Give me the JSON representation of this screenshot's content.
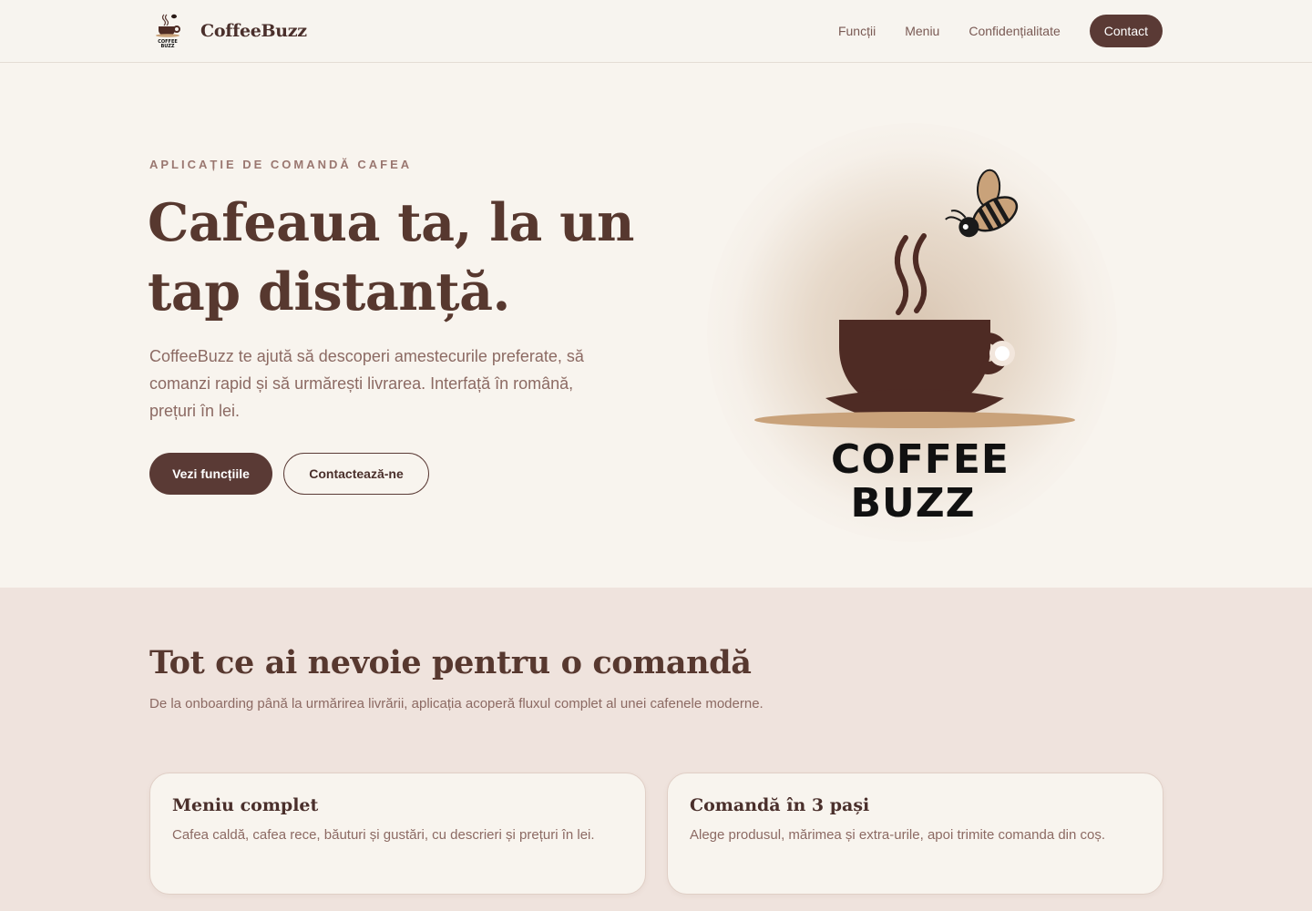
{
  "nav": {
    "brand": "CoffeeBuzz",
    "links": [
      "Funcții",
      "Meniu",
      "Confidențialitate"
    ],
    "contact": "Contact"
  },
  "hero": {
    "eyebrow": "APLICAȚIE DE COMANDĂ CAFEA",
    "title": "Cafeaua ta, la un tap distanță.",
    "description": "CoffeeBuzz te ajută să descoperi amestecurile preferate, să comanzi rapid și să urmărești livrarea. Interfață în română, prețuri în lei.",
    "primary_button": "Vezi funcțiile",
    "secondary_button": "Contactează-ne",
    "logo_text_line1": "COFFEE",
    "logo_text_line2": "BUZZ"
  },
  "features": {
    "title": "Tot ce ai nevoie pentru o comandă",
    "description": "De la onboarding până la urmărirea livrării, aplicația acoperă fluxul complet al unei cafenele moderne.",
    "cards": [
      {
        "title": "Meniu complet",
        "description": "Cafea caldă, cafea rece, băuturi și gustări, cu descrieri și prețuri în lei."
      },
      {
        "title": "Comandă în 3 pași",
        "description": "Alege produsul, mărimea și extra-urile, apoi trimite comanda din coș."
      }
    ]
  },
  "colors": {
    "brand_dark": "#5a3a35",
    "cup": "#4e2b24",
    "saucer": "#c9a27a",
    "background": "#f8f4ee",
    "section_bg": "#efe3dd"
  },
  "icons": [
    "coffee-cup-bee-logo-icon"
  ]
}
